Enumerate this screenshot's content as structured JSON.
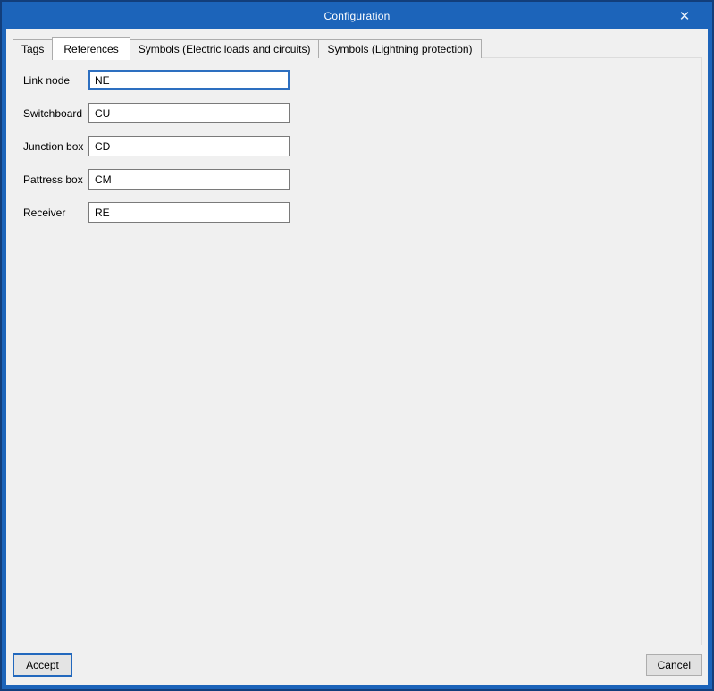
{
  "window": {
    "title": "Configuration",
    "close_icon": "✕"
  },
  "tabs": [
    {
      "label": "Tags",
      "active": false
    },
    {
      "label": "References",
      "active": true
    },
    {
      "label": "Symbols (Electric loads and circuits)",
      "active": false
    },
    {
      "label": "Symbols (Lightning protection)",
      "active": false
    }
  ],
  "form": {
    "fields": [
      {
        "label": "Link node",
        "value": "NE",
        "focused": true
      },
      {
        "label": "Switchboard",
        "value": "CU",
        "focused": false
      },
      {
        "label": "Junction box",
        "value": "CD",
        "focused": false
      },
      {
        "label": "Pattress box",
        "value": "CM",
        "focused": false
      },
      {
        "label": "Receiver",
        "value": "RE",
        "focused": false
      }
    ]
  },
  "footer": {
    "accept": {
      "mnemonic": "A",
      "rest": "ccept"
    },
    "cancel_label": "Cancel"
  },
  "colors": {
    "titlebar": "#1C64BA",
    "window_border_outer": "#123E7B",
    "dialog_bg": "#F0F0F0",
    "focus_blue": "#2D6FC0",
    "accept_border": "#2268BD"
  }
}
